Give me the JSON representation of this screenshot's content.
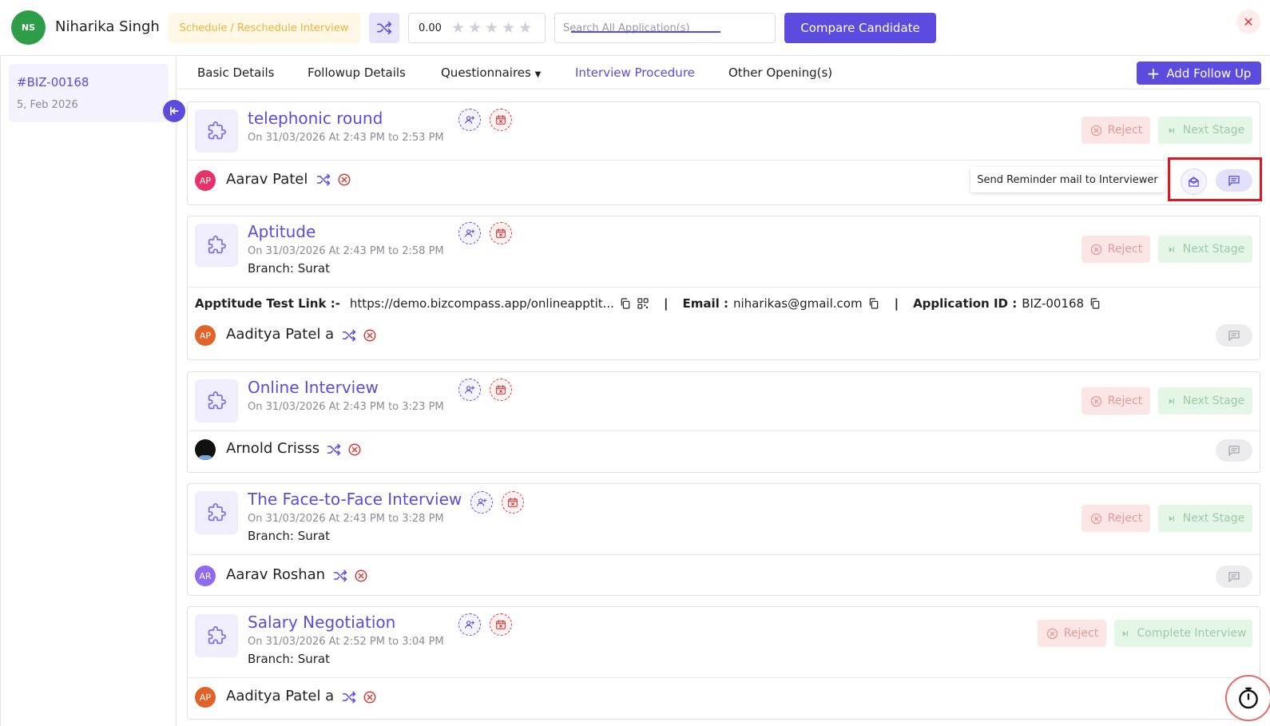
{
  "header": {
    "avatar_initials": "NS",
    "candidate_name": "Niharika Singh",
    "schedule_label": "Schedule / Reschedule Interview",
    "rating_value": "0.00",
    "rating_stars": 0,
    "search_placeholder": "Search All Application(s)",
    "compare_label": "Compare Candidate",
    "close_symbol": "✕"
  },
  "sidebar": {
    "application_id": "#BIZ-00168",
    "application_date": "5, Feb 2026"
  },
  "tabs": [
    {
      "label": "Basic Details"
    },
    {
      "label": "Followup Details"
    },
    {
      "label": "Questionnaires"
    },
    {
      "label": "Interview Procedure"
    },
    {
      "label": "Other Opening(s)"
    }
  ],
  "add_follow_up_label": "Add Follow Up",
  "stages": [
    {
      "title": "telephonic round",
      "time": "On 31/03/2026 At 2:43 PM to 2:53 PM",
      "reject_label": "Reject",
      "next_label": "Next Stage",
      "interviewer": {
        "initials": "AP",
        "name": "Aarav Patel"
      }
    },
    {
      "title": "Aptitude",
      "time": "On 31/03/2026 At 2:43 PM to 2:58 PM",
      "branch": "Branch: Surat",
      "reject_label": "Reject",
      "next_label": "Next Stage",
      "test_link_label": "Apptitude Test Link :-",
      "test_link": "https://demo.bizcompass.app/onlineapptit...",
      "email_label": "Email :",
      "email": "niharikas@gmail.com",
      "app_id_label": "Application ID :",
      "app_id": "BIZ-00168",
      "interviewer": {
        "initials": "AP",
        "name": "Aaditya Patel a"
      }
    },
    {
      "title": "Online Interview",
      "time": "On 31/03/2026 At 2:43 PM to 3:23 PM",
      "reject_label": "Reject",
      "next_label": "Next Stage",
      "interviewer": {
        "initials": "",
        "name": "Arnold Crisss"
      }
    },
    {
      "title": "The Face-to-Face Interview",
      "time": "On 31/03/2026 At 2:43 PM to 3:28 PM",
      "branch": "Branch: Surat",
      "reject_label": "Reject",
      "next_label": "Next Stage",
      "interviewer": {
        "initials": "AR",
        "name": "Aarav Roshan"
      }
    },
    {
      "title": "Salary Negotiation",
      "time": "On 31/03/2026 At 2:52 PM to 3:04 PM",
      "branch": "Branch: Surat",
      "reject_label": "Reject",
      "next_label": "Complete Interview",
      "interviewer": {
        "initials": "AP",
        "name": "Aaditya Patel a"
      }
    }
  ],
  "tooltip": "Send Reminder mail to Interviewer",
  "colors": {
    "primary": "#5b4bdf",
    "reject_bg": "#fbe5e5",
    "next_bg": "#e4f6e6",
    "highlight": "#e0171f",
    "avatar_ns": "#2e9d47",
    "avatar_ap_pink": "#e8336a",
    "avatar_ap_orange": "#e2632a",
    "avatar_ar": "#8e6bf0"
  }
}
